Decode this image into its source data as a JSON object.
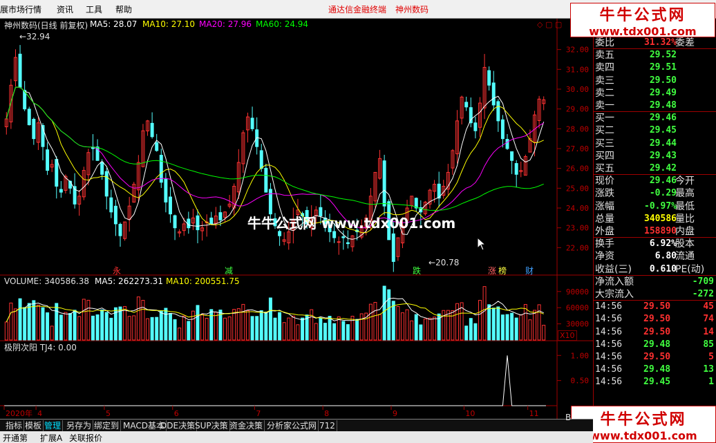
{
  "menu": {
    "items": [
      "展市场行情",
      "资讯",
      "工具",
      "帮助"
    ],
    "terminal_title": "通达信金融终端",
    "stock_title": "神州数码"
  },
  "logo_top": {
    "name": "牛牛公式网",
    "url": "www.tdx001.com"
  },
  "logo_bottom": {
    "name": "牛牛公式网",
    "url": "www.tdx001.com"
  },
  "watermark": "牛牛公式网 www.tdx001.com",
  "main_chart": {
    "title": "神州数码(日线 前复权)",
    "ma_labels": [
      "MA5: 28.07",
      "MA10: 27.10",
      "MA20: 27.96",
      "MA60: 24.94"
    ],
    "ma_colors": [
      "#ffffff",
      "#ffff00",
      "#ff00ff",
      "#00ff00"
    ],
    "high_label": "32.94",
    "low_label": "20.78",
    "y_ticks": [
      "32.00",
      "31.00",
      "30.00",
      "29.00",
      "28.00",
      "27.00",
      "26.00",
      "25.00",
      "24.00",
      "23.00",
      "22.00"
    ],
    "events": [
      "永",
      "减",
      "跌",
      "涨",
      "榜",
      "财"
    ],
    "event_colors": [
      "#ff3030",
      "#40ff40",
      "#40ff40",
      "#ff6060",
      "#ffff40",
      "#40a0ff"
    ]
  },
  "chart_data": {
    "type": "candlestick",
    "price_ylim": [
      21.0,
      33.0
    ],
    "period": "daily",
    "x_ticks": [
      "2020年",
      "4",
      "5",
      "6",
      "7",
      "8",
      "9",
      "10",
      "11"
    ],
    "closes": [
      28.5,
      30.2,
      31.6,
      30.1,
      29.0,
      28.2,
      27.5,
      28.3,
      27.1,
      25.9,
      26.2,
      25.1,
      24.8,
      25.6,
      25.0,
      24.2,
      24.6,
      25.9,
      26.8,
      27.0,
      26.4,
      25.7,
      24.6,
      23.8,
      23.2,
      22.6,
      23.3,
      24.1,
      25.2,
      26.3,
      27.9,
      28.4,
      27.6,
      26.9,
      25.3,
      24.3,
      23.7,
      23.0,
      22.8,
      23.2,
      23.0,
      23.5,
      22.9,
      23.0,
      23.3,
      23.2,
      23.6,
      23.4,
      23.8,
      24.2,
      25.1,
      26.3,
      27.8,
      28.6,
      28.0,
      27.1,
      26.0,
      24.8,
      23.7,
      23.1,
      22.6,
      22.4,
      22.8,
      23.4,
      23.9,
      23.6,
      23.2,
      23.5,
      23.9,
      23.6,
      23.2,
      22.8,
      22.5,
      22.3,
      22.5,
      22.2,
      22.6,
      22.8,
      23.1,
      23.5,
      24.6,
      25.8,
      26.5,
      24.1,
      22.4,
      21.3,
      22.5,
      23.1,
      24.0,
      24.6,
      24.0,
      23.8,
      24.3,
      24.9,
      25.2,
      24.5,
      25.1,
      25.8,
      26.9,
      28.4,
      29.6,
      29.1,
      28.3,
      27.9,
      29.3,
      31.1,
      30.2,
      29.2,
      28.4,
      27.5,
      27.0,
      26.4,
      25.7,
      25.9,
      26.6,
      27.5,
      28.7,
      29.5,
      29.46
    ],
    "vol_ticks": [
      "90000",
      "60000",
      "30000"
    ],
    "vol_ylim": [
      0,
      100000
    ],
    "volume_label": "VOLUME: 340586.38",
    "volume_ma_labels": [
      "MA5: 262273.31",
      "MA10: 200551.75"
    ],
    "ind_label": "极阴次阳 TJ4: 0.00",
    "ind_ticks": [
      "1.00",
      "0.50"
    ],
    "ind_ylim": [
      0,
      1.1
    ],
    "signal_index": 110,
    "signal_value": 1.0
  },
  "quote": {
    "weibi": {
      "label": "委比",
      "value": "31.32%",
      "right": "委差"
    },
    "asks": [
      {
        "label": "卖五",
        "price": "29.52"
      },
      {
        "label": "卖四",
        "price": "29.51"
      },
      {
        "label": "卖三",
        "price": "29.50"
      },
      {
        "label": "卖二",
        "price": "29.49"
      },
      {
        "label": "卖一",
        "price": "29.48"
      }
    ],
    "bids": [
      {
        "label": "买一",
        "price": "29.46"
      },
      {
        "label": "买二",
        "price": "29.45"
      },
      {
        "label": "买三",
        "price": "29.44"
      },
      {
        "label": "买四",
        "price": "29.43"
      },
      {
        "label": "买五",
        "price": "29.42"
      }
    ],
    "stats": [
      {
        "label": "现价",
        "value": "29.46",
        "right": "今开",
        "color": "#40ff40"
      },
      {
        "label": "涨跌",
        "value": "-0.29",
        "right": "最高",
        "color": "#40ff40"
      },
      {
        "label": "涨幅",
        "value": "-0.97%",
        "right": "最低",
        "color": "#40ff40"
      },
      {
        "label": "总量",
        "value": "340586",
        "right": "量比",
        "color": "#ffff00"
      },
      {
        "label": "外盘",
        "value": "158890",
        "right": "内盘",
        "color": "#ff3030"
      }
    ],
    "stats2": [
      {
        "label": "换手",
        "value": "6.92%",
        "right": "股本",
        "color": "#ffffff"
      },
      {
        "label": "净资",
        "value": "6.80",
        "right": "流通",
        "color": "#ffffff"
      },
      {
        "label": "收益(三)",
        "value": "0.610",
        "right": "PE(动)",
        "color": "#ffffff"
      }
    ],
    "flow": [
      {
        "label": "净流入额",
        "value": "-709",
        "color": "#40ff40"
      },
      {
        "label": "大宗流入",
        "value": "-272",
        "color": "#40ff40"
      }
    ],
    "ticks": [
      {
        "time": "14:56",
        "price": "29.50",
        "vol": "45",
        "color": "#ff3030"
      },
      {
        "time": "14:56",
        "price": "29.50",
        "vol": "74",
        "color": "#ff3030"
      },
      {
        "time": "14:56",
        "price": "29.50",
        "vol": "14",
        "color": "#ff3030"
      },
      {
        "time": "14:56",
        "price": "29.48",
        "vol": "85",
        "color": "#40ff40"
      },
      {
        "time": "14:56",
        "price": "29.50",
        "vol": "5",
        "color": "#ff3030"
      },
      {
        "time": "14:56",
        "price": "29.48",
        "vol": "13",
        "color": "#40ff40"
      },
      {
        "time": "14:56",
        "price": "29.45",
        "vol": "1",
        "color": "#40ff40"
      }
    ],
    "price_color": "#40ff40"
  },
  "tabs": [
    "指标",
    "模板",
    "管理",
    "另存为",
    "绑定到",
    "MACD基本",
    "DDE决策",
    "SUP决策",
    "资金决策",
    "分析家公式网",
    "712"
  ],
  "active_tab": 2,
  "bottom": [
    "开通第",
    "扩展A",
    "关联报价"
  ],
  "x10": "X10",
  "right_edge": "B"
}
